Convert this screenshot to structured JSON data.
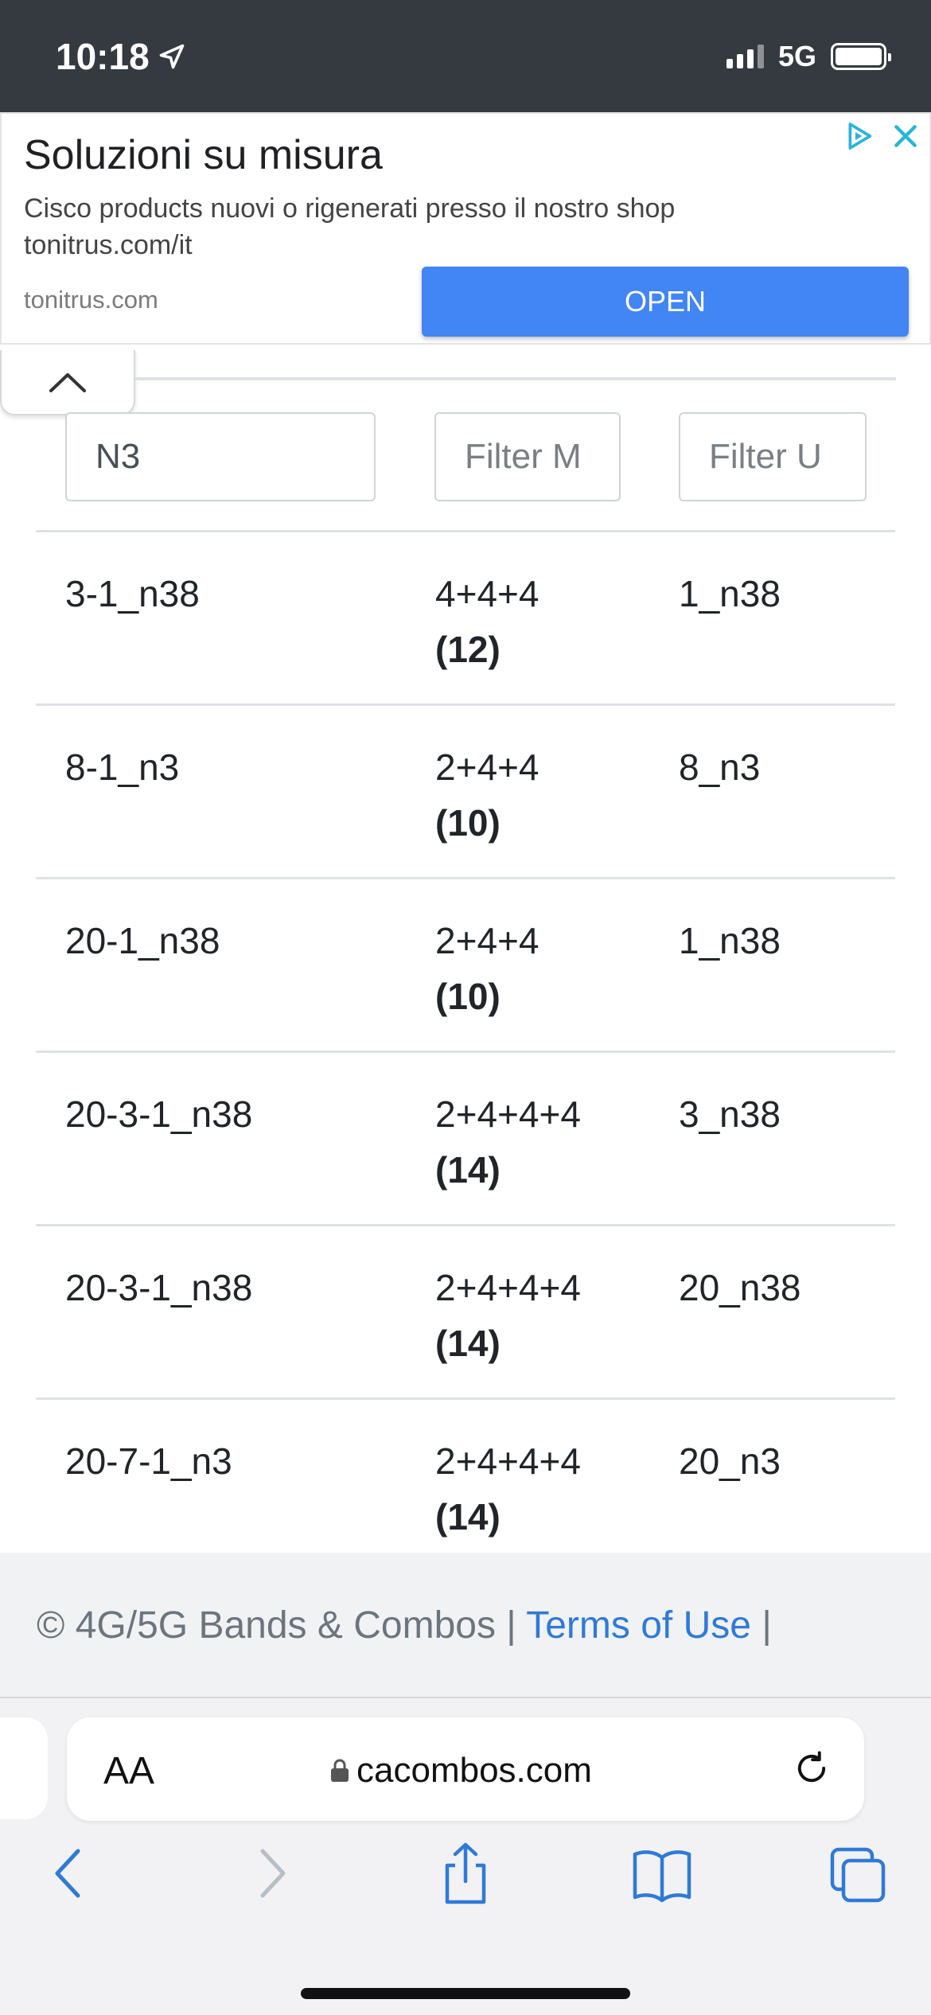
{
  "status_bar": {
    "time": "10:18",
    "network": "5G",
    "icons": [
      "location-arrow-icon",
      "signal-icon",
      "battery-icon"
    ]
  },
  "ad": {
    "title": "Soluzioni su misura",
    "description": "Cisco products nuovi o rigenerati presso il nostro shop tonitrus.com/it",
    "domain": "tonitrus.com",
    "button_label": "OPEN",
    "icons": [
      "adchoices-icon",
      "close-icon"
    ],
    "button_color": "#4285f4"
  },
  "table": {
    "filters": [
      {
        "value": "N3",
        "placeholder": ""
      },
      {
        "value": "",
        "placeholder": "Filter M"
      },
      {
        "value": "",
        "placeholder": "Filter U"
      }
    ],
    "rows": [
      {
        "combo": "3-1_n38",
        "bands": "4+4+4",
        "total": "(12)",
        "uplink": "1_n38"
      },
      {
        "combo": "8-1_n3",
        "bands": "2+4+4",
        "total": "(10)",
        "uplink": "8_n3"
      },
      {
        "combo": "20-1_n38",
        "bands": "2+4+4",
        "total": "(10)",
        "uplink": "1_n38"
      },
      {
        "combo": "20-3-1_n38",
        "bands": "2+4+4+4",
        "total": "(14)",
        "uplink": "3_n38"
      },
      {
        "combo": "20-3-1_n38",
        "bands": "2+4+4+4",
        "total": "(14)",
        "uplink": "20_n38"
      },
      {
        "combo": "20-7-1_n3",
        "bands": "2+4+4+4",
        "total": "(14)",
        "uplink": "20_n3"
      }
    ]
  },
  "footer": {
    "copyright": "© 4G/5G Bands & Combos |",
    "terms_link": "Terms of Use",
    "separator": "|",
    "link_color": "#2f7ad6"
  },
  "browser": {
    "text_size_label": "AA",
    "url": "cacombos.com",
    "toolbar_icons": [
      "back-icon",
      "forward-icon",
      "share-icon",
      "bookmarks-icon",
      "tabs-icon"
    ]
  }
}
